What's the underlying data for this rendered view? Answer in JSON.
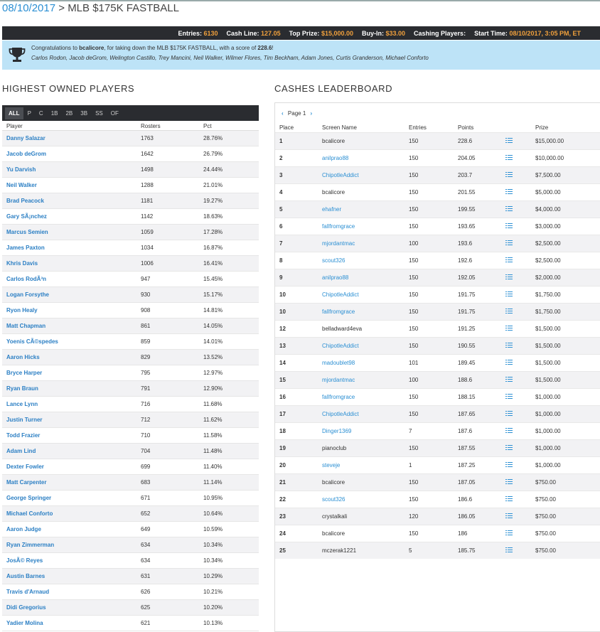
{
  "header": {
    "date": "08/10/2017",
    "separator": " > ",
    "contest_name": "MLB $175K FASTBALL"
  },
  "stats": [
    {
      "label": "Entries:",
      "value": "6130"
    },
    {
      "label": "Cash Line:",
      "value": "127.05"
    },
    {
      "label": "Top Prize:",
      "value": "$15,000.00"
    },
    {
      "label": "Buy-In:",
      "value": "$33.00"
    },
    {
      "label": "Cashing Players:",
      "value": ""
    },
    {
      "label": "Start Time:",
      "value": "08/10/2017, 3:05 PM, ET"
    }
  ],
  "congrats": {
    "prefix": "Congratulations to ",
    "winner": "bcalicore",
    "middle": ", for taking down the MLB $175K FASTBALL, with a score of ",
    "score": "228.6",
    "suffix": "!",
    "lineup": "Carlos Rodon, Jacob deGrom, Welington Castillo, Trey Mancini, Neil Walker, Wilmer Flores, Tim Beckham, Adam Jones, Curtis Granderson, Michael Conforto"
  },
  "highest_owned": {
    "title": "HIGHEST OWNED PLAYERS",
    "tabs": [
      "ALL",
      "P",
      "C",
      "1B",
      "2B",
      "3B",
      "SS",
      "OF"
    ],
    "active_tab": "ALL",
    "columns": [
      "Player",
      "Rosters",
      "Pct"
    ],
    "rows": [
      {
        "player": "Danny Salazar",
        "rosters": "1763",
        "pct": "28.76%"
      },
      {
        "player": "Jacob deGrom",
        "rosters": "1642",
        "pct": "26.79%"
      },
      {
        "player": "Yu Darvish",
        "rosters": "1498",
        "pct": "24.44%"
      },
      {
        "player": "Neil Walker",
        "rosters": "1288",
        "pct": "21.01%"
      },
      {
        "player": "Brad Peacock",
        "rosters": "1181",
        "pct": "19.27%"
      },
      {
        "player": "Gary SÃ¡nchez",
        "rosters": "1142",
        "pct": "18.63%"
      },
      {
        "player": "Marcus Semien",
        "rosters": "1059",
        "pct": "17.28%"
      },
      {
        "player": "James Paxton",
        "rosters": "1034",
        "pct": "16.87%"
      },
      {
        "player": "Khris Davis",
        "rosters": "1006",
        "pct": "16.41%"
      },
      {
        "player": "Carlos RodÃ³n",
        "rosters": "947",
        "pct": "15.45%"
      },
      {
        "player": "Logan Forsythe",
        "rosters": "930",
        "pct": "15.17%"
      },
      {
        "player": "Ryon Healy",
        "rosters": "908",
        "pct": "14.81%"
      },
      {
        "player": "Matt Chapman",
        "rosters": "861",
        "pct": "14.05%"
      },
      {
        "player": "Yoenis CÃ©spedes",
        "rosters": "859",
        "pct": "14.01%"
      },
      {
        "player": "Aaron Hicks",
        "rosters": "829",
        "pct": "13.52%"
      },
      {
        "player": "Bryce Harper",
        "rosters": "795",
        "pct": "12.97%"
      },
      {
        "player": "Ryan Braun",
        "rosters": "791",
        "pct": "12.90%"
      },
      {
        "player": "Lance Lynn",
        "rosters": "716",
        "pct": "11.68%"
      },
      {
        "player": "Justin Turner",
        "rosters": "712",
        "pct": "11.62%"
      },
      {
        "player": "Todd Frazier",
        "rosters": "710",
        "pct": "11.58%"
      },
      {
        "player": "Adam Lind",
        "rosters": "704",
        "pct": "11.48%"
      },
      {
        "player": "Dexter Fowler",
        "rosters": "699",
        "pct": "11.40%"
      },
      {
        "player": "Matt Carpenter",
        "rosters": "683",
        "pct": "11.14%"
      },
      {
        "player": "George Springer",
        "rosters": "671",
        "pct": "10.95%"
      },
      {
        "player": "Michael Conforto",
        "rosters": "652",
        "pct": "10.64%"
      },
      {
        "player": "Aaron Judge",
        "rosters": "649",
        "pct": "10.59%"
      },
      {
        "player": "Ryan Zimmerman",
        "rosters": "634",
        "pct": "10.34%"
      },
      {
        "player": "JosÃ© Reyes",
        "rosters": "634",
        "pct": "10.34%"
      },
      {
        "player": "Austin Barnes",
        "rosters": "631",
        "pct": "10.29%"
      },
      {
        "player": "Travis d'Arnaud",
        "rosters": "626",
        "pct": "10.21%"
      },
      {
        "player": "Didi Gregorius",
        "rosters": "625",
        "pct": "10.20%"
      },
      {
        "player": "Yadier Molina",
        "rosters": "621",
        "pct": "10.13%"
      }
    ]
  },
  "leaderboard": {
    "title": "CASHES LEADERBOARD",
    "pager": {
      "prev": "‹",
      "label": "Page 1",
      "next": "›"
    },
    "columns": [
      "Place",
      "Screen Name",
      "Entries",
      "Points",
      "",
      "Prize"
    ],
    "rows": [
      {
        "place": "1",
        "name": "bcalicore",
        "link": false,
        "entries": "150",
        "points": "228.6",
        "prize": "$15,000.00"
      },
      {
        "place": "2",
        "name": "anilprao88",
        "link": true,
        "entries": "150",
        "points": "204.05",
        "prize": "$10,000.00"
      },
      {
        "place": "3",
        "name": "ChipotleAddict",
        "link": true,
        "entries": "150",
        "points": "203.7",
        "prize": "$7,500.00"
      },
      {
        "place": "4",
        "name": "bcalicore",
        "link": false,
        "entries": "150",
        "points": "201.55",
        "prize": "$5,000.00"
      },
      {
        "place": "5",
        "name": "ehafner",
        "link": true,
        "entries": "150",
        "points": "199.55",
        "prize": "$4,000.00"
      },
      {
        "place": "6",
        "name": "fallfromgrace",
        "link": true,
        "entries": "150",
        "points": "193.65",
        "prize": "$3,000.00"
      },
      {
        "place": "7",
        "name": "mjordantmac",
        "link": true,
        "entries": "100",
        "points": "193.6",
        "prize": "$2,500.00"
      },
      {
        "place": "8",
        "name": "scout326",
        "link": true,
        "entries": "150",
        "points": "192.6",
        "prize": "$2,500.00"
      },
      {
        "place": "9",
        "name": "anilprao88",
        "link": true,
        "entries": "150",
        "points": "192.05",
        "prize": "$2,000.00"
      },
      {
        "place": "10",
        "name": "ChipotleAddict",
        "link": true,
        "entries": "150",
        "points": "191.75",
        "prize": "$1,750.00"
      },
      {
        "place": "10",
        "name": "fallfromgrace",
        "link": true,
        "entries": "150",
        "points": "191.75",
        "prize": "$1,750.00"
      },
      {
        "place": "12",
        "name": "belladward4eva",
        "link": false,
        "entries": "150",
        "points": "191.25",
        "prize": "$1,500.00"
      },
      {
        "place": "13",
        "name": "ChipotleAddict",
        "link": true,
        "entries": "150",
        "points": "190.55",
        "prize": "$1,500.00"
      },
      {
        "place": "14",
        "name": "madoublet98",
        "link": true,
        "entries": "101",
        "points": "189.45",
        "prize": "$1,500.00"
      },
      {
        "place": "15",
        "name": "mjordantmac",
        "link": true,
        "entries": "100",
        "points": "188.6",
        "prize": "$1,500.00"
      },
      {
        "place": "16",
        "name": "fallfromgrace",
        "link": true,
        "entries": "150",
        "points": "188.15",
        "prize": "$1,000.00"
      },
      {
        "place": "17",
        "name": "ChipotleAddict",
        "link": true,
        "entries": "150",
        "points": "187.65",
        "prize": "$1,000.00"
      },
      {
        "place": "18",
        "name": "Dinger1369",
        "link": true,
        "entries": "7",
        "points": "187.6",
        "prize": "$1,000.00"
      },
      {
        "place": "19",
        "name": "pianoclub",
        "link": false,
        "entries": "150",
        "points": "187.55",
        "prize": "$1,000.00"
      },
      {
        "place": "20",
        "name": "steveje",
        "link": true,
        "entries": "1",
        "points": "187.25",
        "prize": "$1,000.00"
      },
      {
        "place": "21",
        "name": "bcalicore",
        "link": false,
        "entries": "150",
        "points": "187.05",
        "prize": "$750.00"
      },
      {
        "place": "22",
        "name": "scout326",
        "link": true,
        "entries": "150",
        "points": "186.6",
        "prize": "$750.00"
      },
      {
        "place": "23",
        "name": "crystalkali",
        "link": false,
        "entries": "120",
        "points": "186.05",
        "prize": "$750.00"
      },
      {
        "place": "24",
        "name": "bcalicore",
        "link": false,
        "entries": "150",
        "points": "186",
        "prize": "$750.00"
      },
      {
        "place": "25",
        "name": "mczerak1221",
        "link": false,
        "entries": "5",
        "points": "185.75",
        "prize": "$750.00"
      }
    ]
  },
  "colors": {
    "link": "#2b8fd3",
    "stat_value": "#f0a03c",
    "dark_bar": "#2a2c30",
    "banner": "#bde3f7"
  },
  "icons": {
    "trophy": "trophy-icon",
    "lineup": "list-icon"
  }
}
